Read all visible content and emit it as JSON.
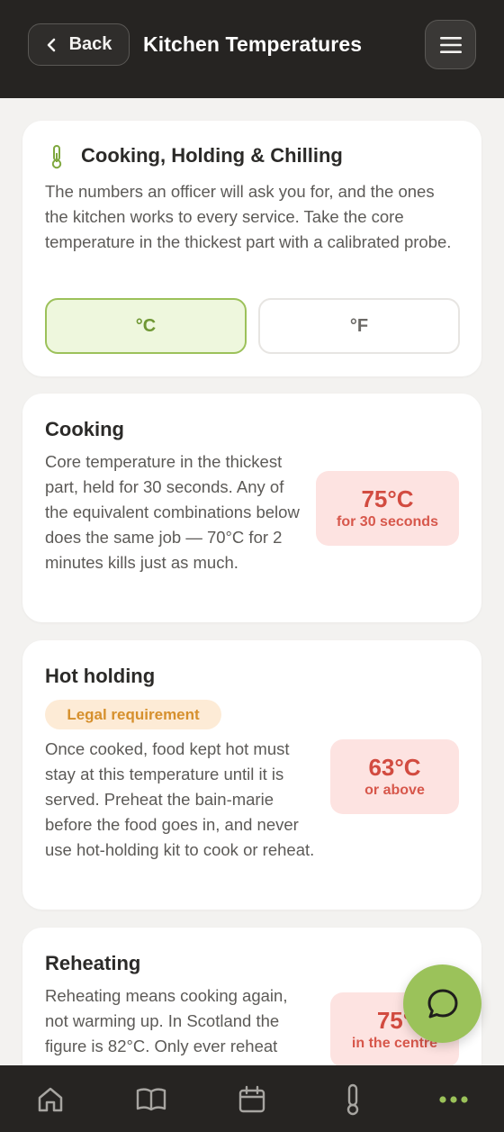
{
  "header": {
    "back_label": "Back",
    "title": "Kitchen Temperatures"
  },
  "intro": {
    "icon": "thermometer-icon",
    "title": "Cooking, Holding & Chilling",
    "description": "The numbers an officer will ask you for, and the ones the kitchen works to every service. Take the core temperature in the thickest part with a calibrated probe.",
    "unit_c": "°C",
    "unit_f": "°F",
    "selected_unit": "°C"
  },
  "sections": [
    {
      "title": "Cooking",
      "description": "Core temperature in the thickest part, held for 30 seconds. Any of the equivalent combinations below does the same job — 70°C for 2 minutes kills just as much.",
      "temp": "75°C",
      "temp_sub": "for 30 seconds"
    },
    {
      "title": "Hot holding",
      "tag": "Legal requirement",
      "description": "Once cooked, food kept hot must stay at this temperature until it is served. Preheat the bain-marie before the food goes in, and never use hot-holding kit to cook or reheat.",
      "temp": "63°C",
      "temp_sub": "or above"
    },
    {
      "title": "Reheating",
      "description": "Reheating means cooking again, not warming up. In Scotland the figure is 82°C. Only ever reheat",
      "temp": "75°",
      "temp_sub": "in the centre"
    }
  ],
  "nav": [
    "home-icon",
    "book-icon",
    "calendar-icon",
    "thermometer-icon",
    "more-icon"
  ],
  "colors": {
    "header_bg": "#262422",
    "accent_green": "#9bc25a",
    "temp_red": "#d24b40",
    "badge_bg": "#fde3e1",
    "tag_orange": "#d6902d"
  }
}
